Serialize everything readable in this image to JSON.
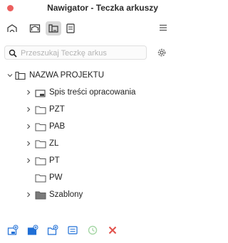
{
  "window": {
    "title": "Nawigator - Teczka arkuszy"
  },
  "toolbar": {
    "buttons": [
      {
        "icon": "project-map-icon",
        "active": false
      },
      {
        "icon": "view-map-icon",
        "active": false
      },
      {
        "icon": "layout-book-icon",
        "active": true
      },
      {
        "icon": "publisher-sets-icon",
        "active": false
      }
    ],
    "menu_icon": "hamburger-menu-icon"
  },
  "search": {
    "placeholder": "Przeszukaj Teczkę arkus",
    "value": ""
  },
  "tree": {
    "root": {
      "label": "NAZWA PROJEKTU",
      "expanded": true
    },
    "items": [
      {
        "label": "Spis treści opracowania",
        "has_children": true,
        "icon": "layout-sheet-icon"
      },
      {
        "label": "PZT",
        "has_children": true,
        "icon": "folder-icon"
      },
      {
        "label": "PAB",
        "has_children": true,
        "icon": "folder-icon"
      },
      {
        "label": "ZL",
        "has_children": true,
        "icon": "folder-icon"
      },
      {
        "label": "PT",
        "has_children": true,
        "icon": "folder-icon"
      },
      {
        "label": "PW",
        "has_children": false,
        "icon": "folder-icon"
      },
      {
        "label": "Szablony",
        "has_children": true,
        "icon": "master-folder-icon"
      }
    ]
  },
  "bottom_toolbar": {
    "buttons": [
      "new-subset-icon",
      "new-master-layout-icon",
      "new-layout-icon",
      "settings-list-icon",
      "refresh-icon",
      "delete-icon"
    ]
  },
  "colors": {
    "accent_blue": "#1f6fd6",
    "delete_red": "#e2504a",
    "close_red": "#ec5f5e",
    "folder_dark": "#7a7a7a"
  }
}
